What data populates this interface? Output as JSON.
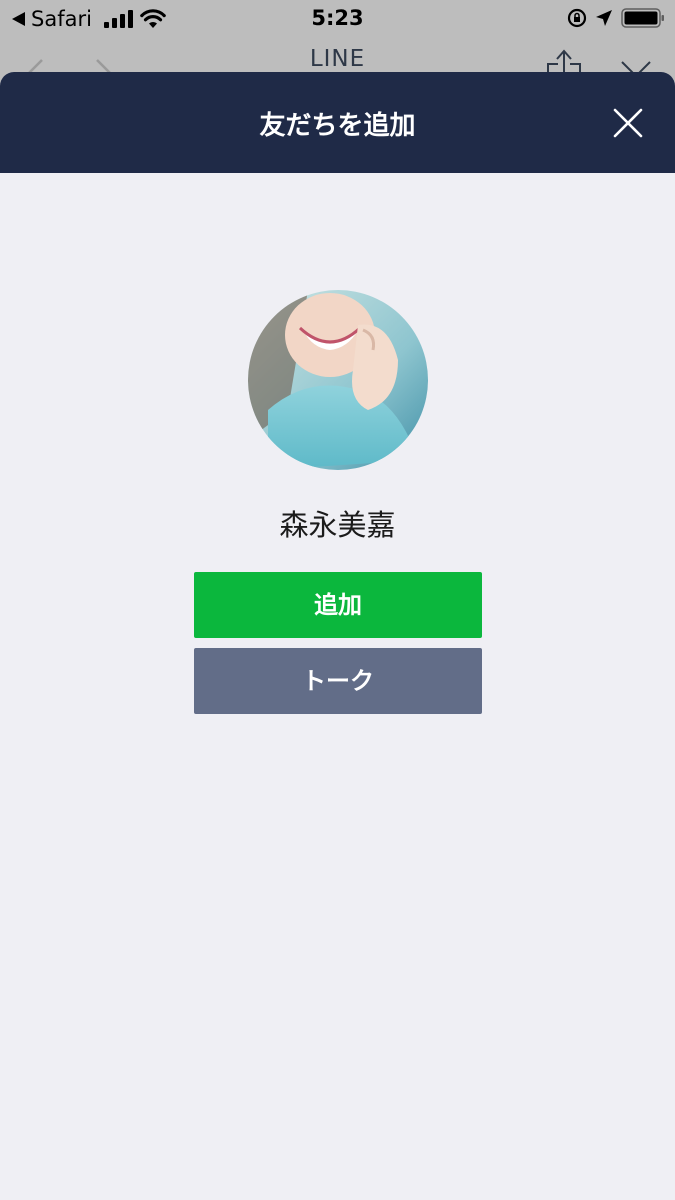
{
  "status_bar": {
    "back_app": "Safari",
    "time": "5:23"
  },
  "browser": {
    "title": "LINE"
  },
  "modal": {
    "title": "友だちを追加",
    "close_icon": "close-icon"
  },
  "profile": {
    "name": "森永美嘉",
    "avatar": "profile-photo"
  },
  "actions": {
    "add_label": "追加",
    "talk_label": "トーク"
  },
  "colors": {
    "header": "#1f2a47",
    "add_button": "#0bb73d",
    "talk_button": "#626d88",
    "background": "#efeff4"
  }
}
